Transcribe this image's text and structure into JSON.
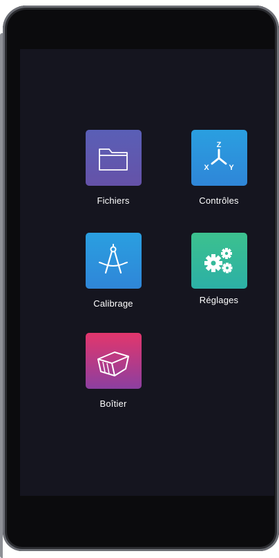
{
  "menu": {
    "items": [
      {
        "label": "Fichiers",
        "icon": "folder-icon",
        "color": "#5a5fb6"
      },
      {
        "label": "Contrôles",
        "icon": "axes-icon",
        "color": "#2a9fe0",
        "axes": [
          "Z",
          "X",
          "Y"
        ]
      },
      {
        "label": "Calibrage",
        "icon": "compass-icon",
        "color": "#2a9fe0"
      },
      {
        "label": "Réglages",
        "icon": "gears-icon",
        "color": "#3cc18e"
      },
      {
        "label": "Boîtier",
        "icon": "box-icon",
        "color": "#e2366c"
      }
    ]
  }
}
